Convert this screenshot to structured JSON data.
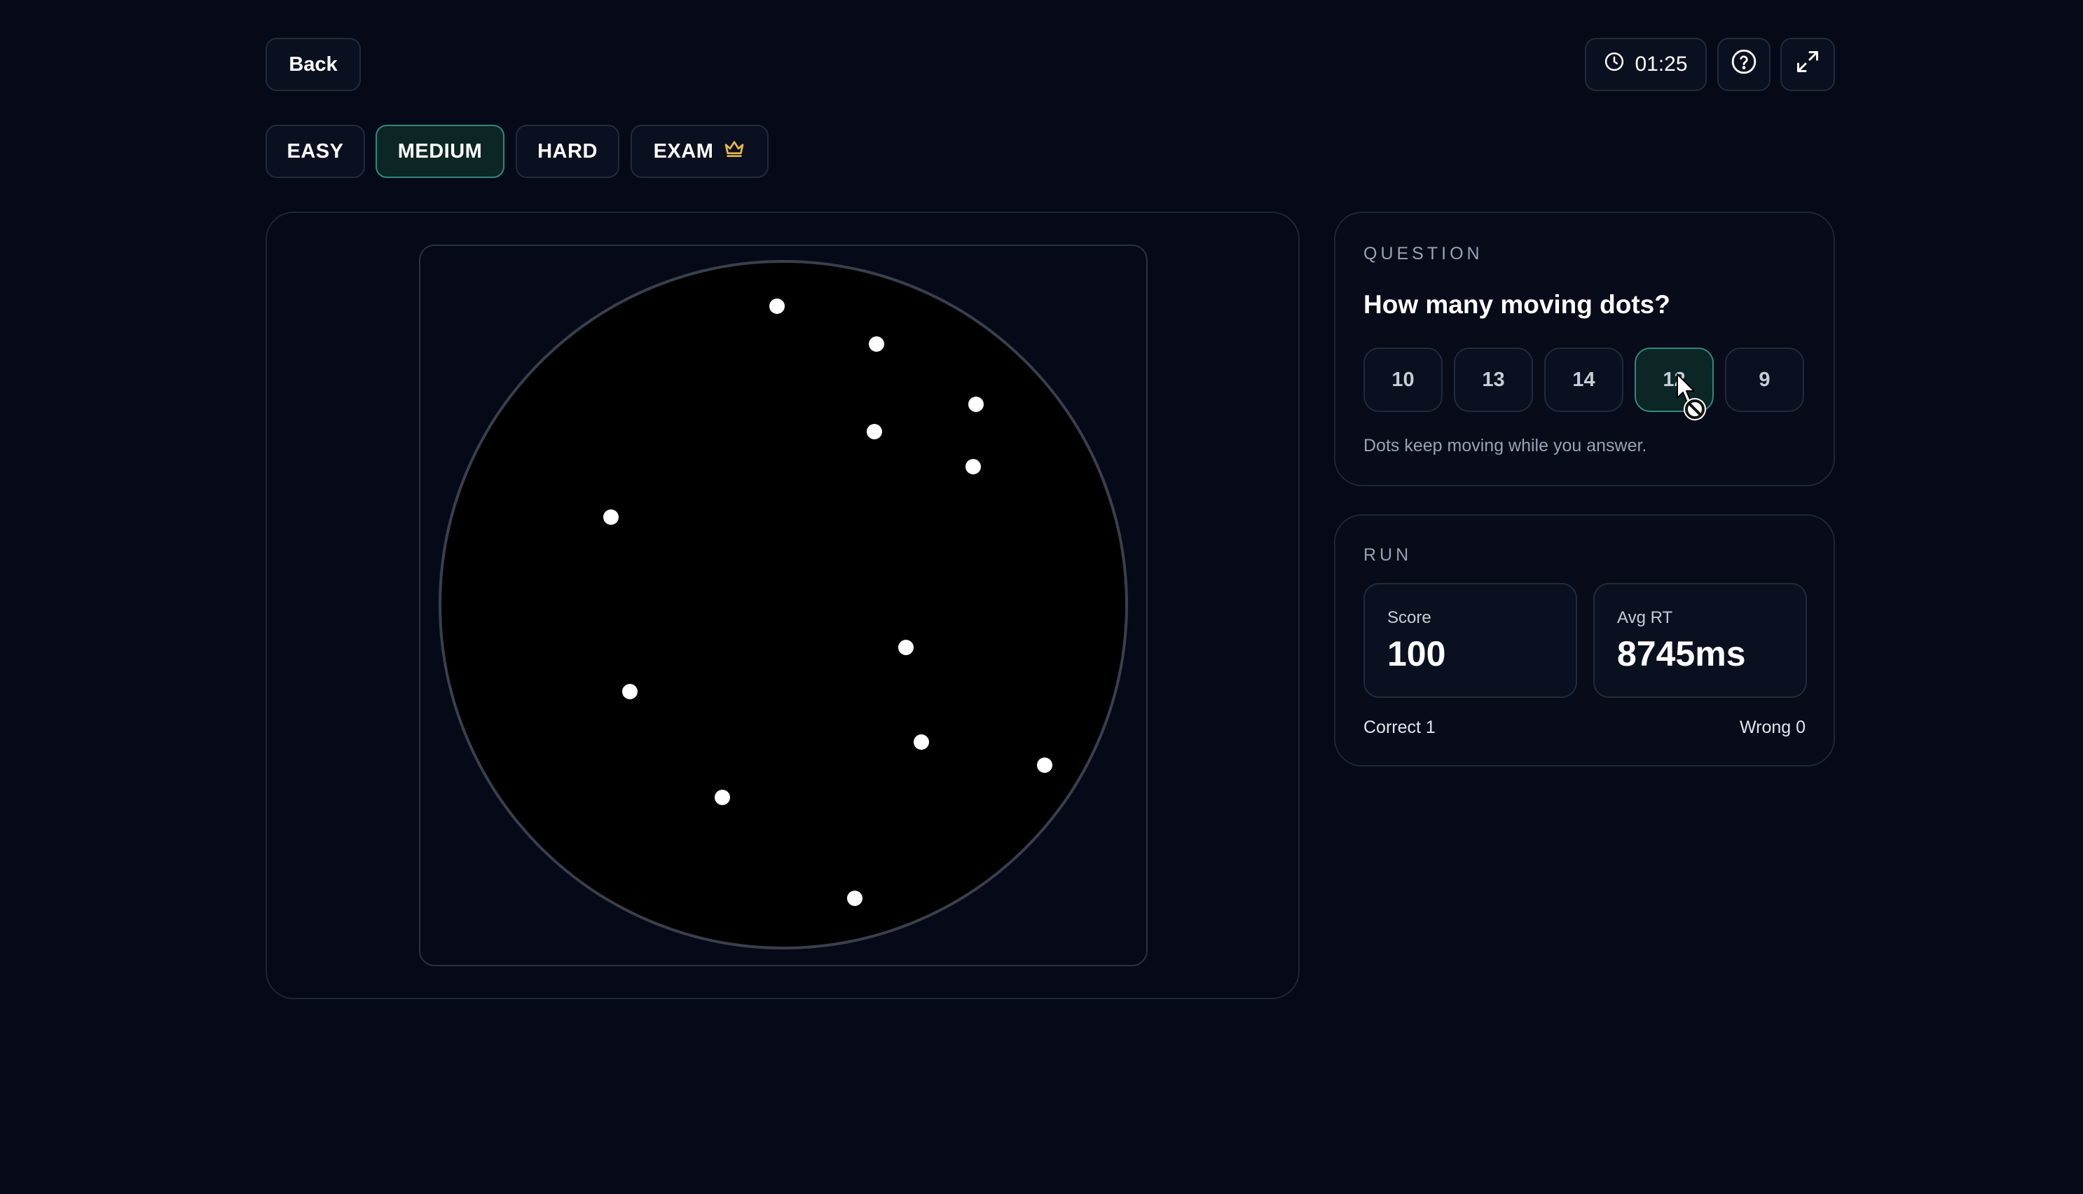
{
  "top_bar": {
    "back_label": "Back",
    "timer": "01:25",
    "icons": {
      "timer": "clock-icon",
      "help": "question-circle-icon",
      "expand": "expand-icon"
    }
  },
  "difficulty_tabs": [
    {
      "label": "EASY",
      "selected": false
    },
    {
      "label": "MEDIUM",
      "selected": true
    },
    {
      "label": "HARD",
      "selected": false
    },
    {
      "label": "EXAM",
      "selected": false,
      "icon": "crown-icon"
    }
  ],
  "question": {
    "section_label": "QUESTION",
    "prompt": "How many moving dots?",
    "answers": [
      {
        "label": "10",
        "hovered": false
      },
      {
        "label": "13",
        "hovered": false
      },
      {
        "label": "14",
        "hovered": false
      },
      {
        "label": "12",
        "hovered": true
      },
      {
        "label": "9",
        "hovered": false
      }
    ],
    "hint": "Dots keep moving while you answer."
  },
  "run": {
    "section_label": "RUN",
    "score_label": "Score",
    "score_value": "100",
    "avg_rt_label": "Avg RT",
    "avg_rt_value": "8745ms",
    "correct_text": "Correct 1",
    "wrong_text": "Wrong 0"
  },
  "colors": {
    "background": "#060a18",
    "accent_border": "#2f8a7c",
    "accent_fill": "#0c2625",
    "crown": "#e8b84a",
    "dot": "#ffffff",
    "arena": "#000000"
  }
}
